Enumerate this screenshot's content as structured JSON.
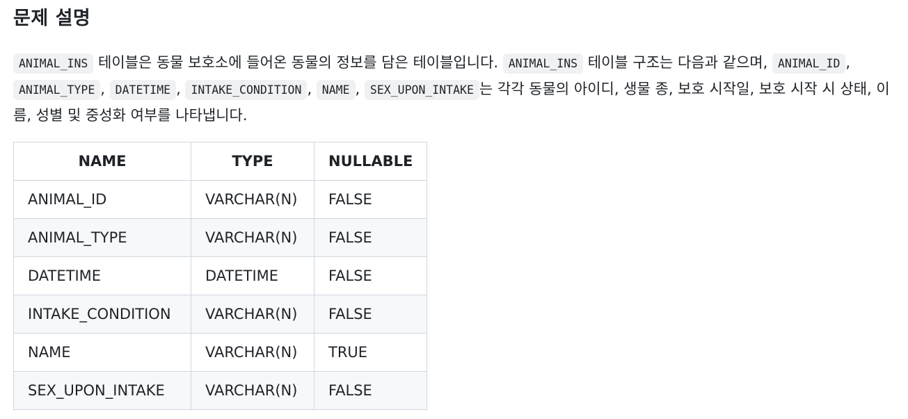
{
  "title": "문제 설명",
  "description": {
    "code_1": "ANIMAL_INS",
    "text_1": " 테이블은 동물 보호소에 들어온 동물의 정보를 담은 테이블입니다. ",
    "code_2": "ANIMAL_INS",
    "text_2": " 테이블 구조는 다음과 같으며, ",
    "code_3": "ANIMAL_ID",
    "sep_1": ", ",
    "code_4": "ANIMAL_TYPE",
    "sep_2": ", ",
    "code_5": "DATETIME",
    "sep_3": ", ",
    "code_6": "INTAKE_CONDITION",
    "sep_4": ", ",
    "code_7": "NAME",
    "sep_5": ", ",
    "code_8": "SEX_UPON_INTAKE",
    "text_3": "는 각각 동물의 아이디, 생물 종, 보호 시작일, 보호 시작 시 상태, 이름, 성별 및 중성화 여부를 나타냅니다."
  },
  "table": {
    "headers": [
      "NAME",
      "TYPE",
      "NULLABLE"
    ],
    "rows": [
      [
        "ANIMAL_ID",
        "VARCHAR(N)",
        "FALSE"
      ],
      [
        "ANIMAL_TYPE",
        "VARCHAR(N)",
        "FALSE"
      ],
      [
        "DATETIME",
        "DATETIME",
        "FALSE"
      ],
      [
        "INTAKE_CONDITION",
        "VARCHAR(N)",
        "FALSE"
      ],
      [
        "NAME",
        "VARCHAR(N)",
        "TRUE"
      ],
      [
        "SEX_UPON_INTAKE",
        "VARCHAR(N)",
        "FALSE"
      ]
    ]
  }
}
